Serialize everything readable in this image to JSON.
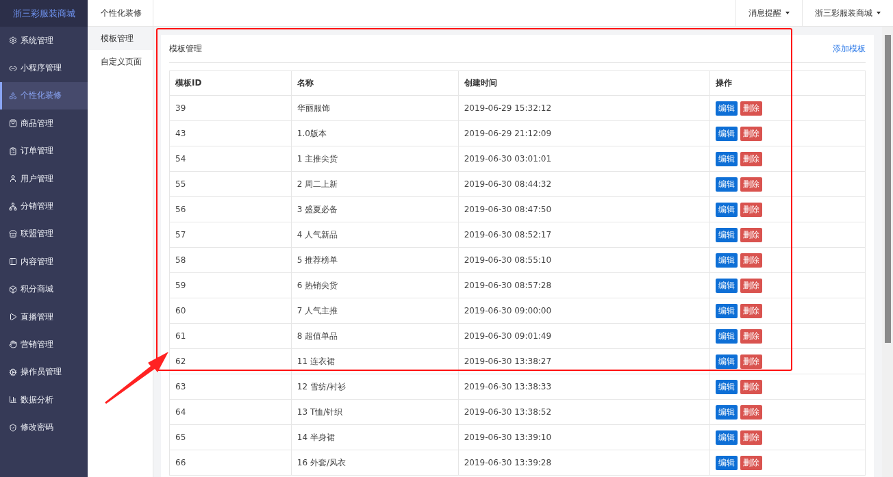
{
  "brand": "浙三彩服装商城",
  "sidebar": {
    "items": [
      {
        "label": "系统管理",
        "selected": false
      },
      {
        "label": "小程序管理",
        "selected": false
      },
      {
        "label": "个性化装修",
        "selected": true
      },
      {
        "label": "商品管理",
        "selected": false
      },
      {
        "label": "订单管理",
        "selected": false
      },
      {
        "label": "用户管理",
        "selected": false
      },
      {
        "label": "分销管理",
        "selected": false
      },
      {
        "label": "联盟管理",
        "selected": false
      },
      {
        "label": "内容管理",
        "selected": false
      },
      {
        "label": "积分商城",
        "selected": false
      },
      {
        "label": "直播管理",
        "selected": false
      },
      {
        "label": "营销管理",
        "selected": false
      },
      {
        "label": "操作员管理",
        "selected": false
      },
      {
        "label": "数据分析",
        "selected": false
      },
      {
        "label": "修改密码",
        "selected": false
      }
    ]
  },
  "submenu": {
    "title": "个性化装修",
    "items": [
      {
        "label": "模板管理",
        "selected": true
      },
      {
        "label": "自定义页面",
        "selected": false
      }
    ]
  },
  "topbar": {
    "menus": [
      "消息提醒",
      "浙三彩服装商城"
    ]
  },
  "card": {
    "title": "模板管理",
    "action": "添加模板"
  },
  "table": {
    "columns": [
      "模板ID",
      "名称",
      "创建时间",
      "操作"
    ],
    "rows": [
      {
        "id": "39",
        "name": "华丽服饰",
        "created": "2019-06-29 15:32:12",
        "edit": "编辑",
        "delete": "删除"
      },
      {
        "id": "43",
        "name": "1.0版本",
        "created": "2019-06-29 21:12:09",
        "edit": "编辑",
        "delete": "删除"
      },
      {
        "id": "54",
        "name": "1 主推尖货",
        "created": "2019-06-30 03:01:01",
        "edit": "编辑",
        "delete": "删除"
      },
      {
        "id": "55",
        "name": "2 周二上新",
        "created": "2019-06-30 08:44:32",
        "edit": "编辑",
        "delete": "删除"
      },
      {
        "id": "56",
        "name": "3 盛夏必备",
        "created": "2019-06-30 08:47:50",
        "edit": "编辑",
        "delete": "删除"
      },
      {
        "id": "57",
        "name": "4 人气新品",
        "created": "2019-06-30 08:52:17",
        "edit": "编辑",
        "delete": "删除"
      },
      {
        "id": "58",
        "name": "5 推荐榜单",
        "created": "2019-06-30 08:55:10",
        "edit": "编辑",
        "delete": "删除"
      },
      {
        "id": "59",
        "name": "6 热销尖货",
        "created": "2019-06-30 08:57:28",
        "edit": "编辑",
        "delete": "删除"
      },
      {
        "id": "60",
        "name": "7 人气主推",
        "created": "2019-06-30 09:00:00",
        "edit": "编辑",
        "delete": "删除"
      },
      {
        "id": "61",
        "name": "8 超值单品",
        "created": "2019-06-30 09:01:49",
        "edit": "编辑",
        "delete": "删除"
      },
      {
        "id": "62",
        "name": "11 连衣裙",
        "created": "2019-06-30 13:38:27",
        "edit": "编辑",
        "delete": "删除"
      },
      {
        "id": "63",
        "name": "12 雪纺/衬衫",
        "created": "2019-06-30 13:38:33",
        "edit": "编辑",
        "delete": "删除"
      },
      {
        "id": "64",
        "name": "13 T恤/针织",
        "created": "2019-06-30 13:38:52",
        "edit": "编辑",
        "delete": "删除"
      },
      {
        "id": "65",
        "name": "14 半身裙",
        "created": "2019-06-30 13:39:10",
        "edit": "编辑",
        "delete": "删除"
      },
      {
        "id": "66",
        "name": "16 外套/风衣",
        "created": "2019-06-30 13:39:28",
        "edit": "编辑",
        "delete": "删除"
      }
    ]
  }
}
